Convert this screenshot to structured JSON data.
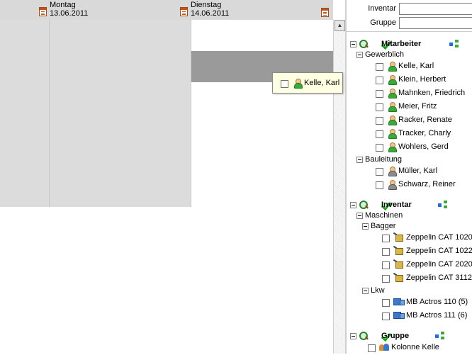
{
  "calendar": {
    "days": [
      {
        "weekday": "Montag",
        "date": "13.06.2011"
      },
      {
        "weekday": "Dienstag",
        "date": "14.06.2011"
      }
    ],
    "selected_cell": {
      "row": 2,
      "column": "Dienstag"
    }
  },
  "tooltip": {
    "label": "Kelle, Karl",
    "icon": "person-icon"
  },
  "filters": {
    "inventar_label": "Inventar",
    "inventar_value": "",
    "gruppe_label": "Gruppe",
    "gruppe_value": ""
  },
  "tree": {
    "mitarbeiter": {
      "title": "Mitarbeiter",
      "gewerblich": {
        "label": "Gewerblich",
        "items": [
          "Kelle, Karl",
          "Klein, Herbert",
          "Mahnken, Friedrich",
          "Meier, Fritz",
          "Racker, Renate",
          "Tracker, Charly",
          "Wohlers, Gerd"
        ]
      },
      "bauleitung": {
        "label": "Bauleitung",
        "items": [
          "Müller, Karl",
          "Schwarz, Reiner"
        ]
      }
    },
    "inventar": {
      "title": "Inventar",
      "maschinen": {
        "label": "Maschinen",
        "bagger": {
          "label": "Bagger",
          "items": [
            "Zeppelin CAT 1020",
            "Zeppelin CAT 1022",
            "Zeppelin CAT 2020",
            "Zeppelin CAT 3112"
          ]
        }
      },
      "lkw": {
        "label": "Lkw",
        "items": [
          "MB Actros 110 (5)",
          "MB Actros 111 (6)"
        ]
      }
    },
    "gruppe": {
      "title": "Gruppe",
      "items": [
        "Kolonne Kelle"
      ]
    }
  },
  "colors": {
    "calendar_header": "#d9d9d9",
    "past_day_cell": "#dcdcdc",
    "selected_cell": "#9a9a9a",
    "tooltip_bg": "#ffffe1"
  }
}
